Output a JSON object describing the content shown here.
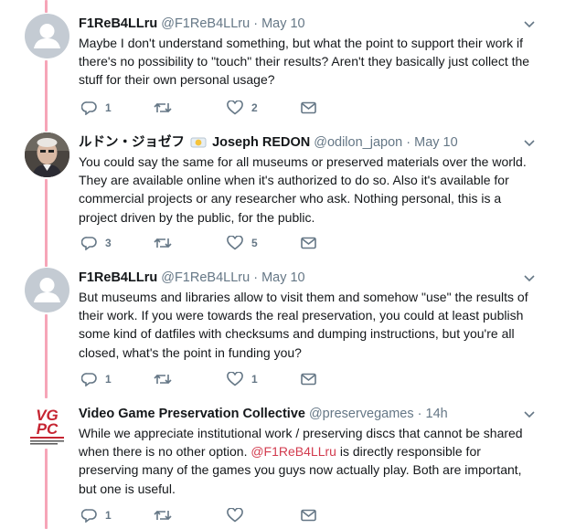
{
  "tweets": [
    {
      "name": "F1ReB4LLru",
      "badge": "",
      "handle": "@F1ReB4LLru",
      "dot": "·",
      "time": "May 10",
      "text": "Maybe I don't understand something, but what the point to support their work if there's no possibility to \"touch\" their results? Aren't they basically just collect the stuff for their own personal usage?",
      "replies": "1",
      "retweets": "",
      "likes": "2",
      "avatar": "default-avatar-icon"
    },
    {
      "name": "ルドン・ジョゼフ",
      "badge": "Joseph REDON",
      "handle": "@odilon_japon",
      "dot": "·",
      "time": "May 10",
      "text": "You could say the same for all museums or preserved materials over the world. They are available online when it's authorized to do so. Also it's available for commercial projects or any researcher who ask. Nothing personal, this is a project driven by the public, for the public.",
      "replies": "3",
      "retweets": "",
      "likes": "5",
      "avatar": "photo-avatar"
    },
    {
      "name": "F1ReB4LLru",
      "badge": "",
      "handle": "@F1ReB4LLru",
      "dot": "·",
      "time": "May 10",
      "text": "But museums and libraries allow to visit them and somehow \"use\" the results of their work. If you were towards the real preservation, you could at least publish some kind of datfiles with checksums and dumping instructions, but you're all closed, what's the point in funding you?",
      "replies": "1",
      "retweets": "",
      "likes": "1",
      "avatar": "default-avatar-icon"
    },
    {
      "name": "Video Game Preservation Collective",
      "badge": "",
      "handle": "@preservegames",
      "dot": "·",
      "time": "14h",
      "text_before": "While we appreciate institutional work / preserving discs that cannot be shared when there is no other option. ",
      "mention": "@F1ReB4LLru",
      "text_after": " is directly responsible for preserving many of the games you guys now actually play. Both are important, but one is useful.",
      "replies": "1",
      "retweets": "",
      "likes": "",
      "avatar": "vgpc-logo",
      "logo_text": "VGPC"
    }
  ],
  "colors": {
    "thread_line": "#f6a5b8",
    "mention": "#d23b4e",
    "muted": "#657786"
  }
}
